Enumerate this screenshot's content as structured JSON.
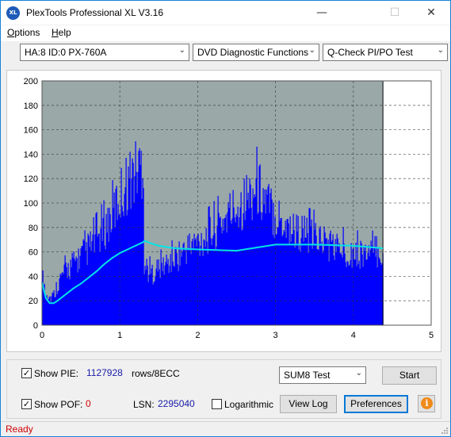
{
  "window": {
    "title": "PlexTools Professional XL V3.16",
    "app_icon_text": "XL"
  },
  "menu": [
    {
      "label": "Options",
      "mnemonic": "O",
      "rest": "ptions"
    },
    {
      "label": "Help",
      "mnemonic": "H",
      "rest": "elp"
    }
  ],
  "toolbar": {
    "drive": "HA:8 ID:0  PX-760A",
    "function": "DVD Diagnostic Functions",
    "test": "Q-Check PI/PO Test"
  },
  "chart_data": {
    "type": "bar",
    "title": "",
    "xlabel": "",
    "ylabel": "",
    "xlim": [
      0,
      5
    ],
    "ylim": [
      0,
      200
    ],
    "x_ticks": [
      "0",
      "1",
      "2",
      "3",
      "4",
      "5"
    ],
    "y_ticks": [
      "0",
      "20",
      "40",
      "60",
      "80",
      "100",
      "120",
      "140",
      "160",
      "180",
      "200"
    ],
    "grid": true,
    "scan_end": 4.38,
    "colors": {
      "bars": "#0000ff",
      "line": "#00e5e5",
      "plot_bg": "#9aa8a8",
      "end_marker": "#000000"
    },
    "series": [
      {
        "type": "bar",
        "x": [
          0.0,
          0.05,
          0.1,
          0.15,
          0.2,
          0.3,
          0.4,
          0.5,
          0.6,
          0.7,
          0.8,
          0.9,
          1.0,
          1.05,
          1.1,
          1.15,
          1.2,
          1.25,
          1.31,
          1.33,
          1.4,
          1.5,
          1.6,
          1.7,
          1.8,
          1.9,
          2.0,
          2.1,
          2.2,
          2.3,
          2.4,
          2.5,
          2.6,
          2.7,
          2.75,
          2.8,
          2.85,
          2.9,
          3.0,
          3.1,
          3.2,
          3.3,
          3.4,
          3.5,
          3.6,
          3.7,
          3.8,
          3.9,
          4.0,
          4.1,
          4.2,
          4.3,
          4.38
        ],
        "values": [
          52,
          35,
          28,
          30,
          42,
          55,
          62,
          70,
          78,
          88,
          98,
          112,
          130,
          138,
          145,
          150,
          155,
          160,
          168,
          60,
          52,
          58,
          62,
          68,
          74,
          80,
          84,
          90,
          96,
          104,
          112,
          120,
          126,
          134,
          140,
          136,
          128,
          122,
          112,
          104,
          98,
          94,
          92,
          90,
          86,
          82,
          78,
          76,
          74,
          74,
          72,
          76,
          72
        ]
      },
      {
        "type": "line",
        "x": [
          0.0,
          0.05,
          0.1,
          0.15,
          0.2,
          0.3,
          0.4,
          0.5,
          0.6,
          0.7,
          0.8,
          0.9,
          1.0,
          1.1,
          1.2,
          1.3,
          1.32,
          1.4,
          1.5,
          1.7,
          2.0,
          2.5,
          3.0,
          3.5,
          4.0,
          4.38
        ],
        "values": [
          35,
          22,
          18,
          18,
          20,
          25,
          30,
          34,
          39,
          44,
          50,
          55,
          59,
          62,
          65,
          68,
          69,
          67,
          65,
          63,
          62,
          61,
          66,
          66,
          65,
          63
        ]
      }
    ]
  },
  "bottom": {
    "show_pie_label": "Show PIE:",
    "pie_value": "1127928",
    "pie_unit": "rows/8ECC",
    "show_pof_label": "Show POF:",
    "pof_value": "0",
    "lsn_label": "LSN:",
    "lsn_value": "2295040",
    "logarithmic_label": "Logarithmic",
    "test_select": "SUM8 Test",
    "start_button": "Start",
    "view_log_button": "View Log",
    "preferences_button": "Preferences",
    "info_icon_text": "i"
  },
  "status": {
    "text": "Ready"
  }
}
